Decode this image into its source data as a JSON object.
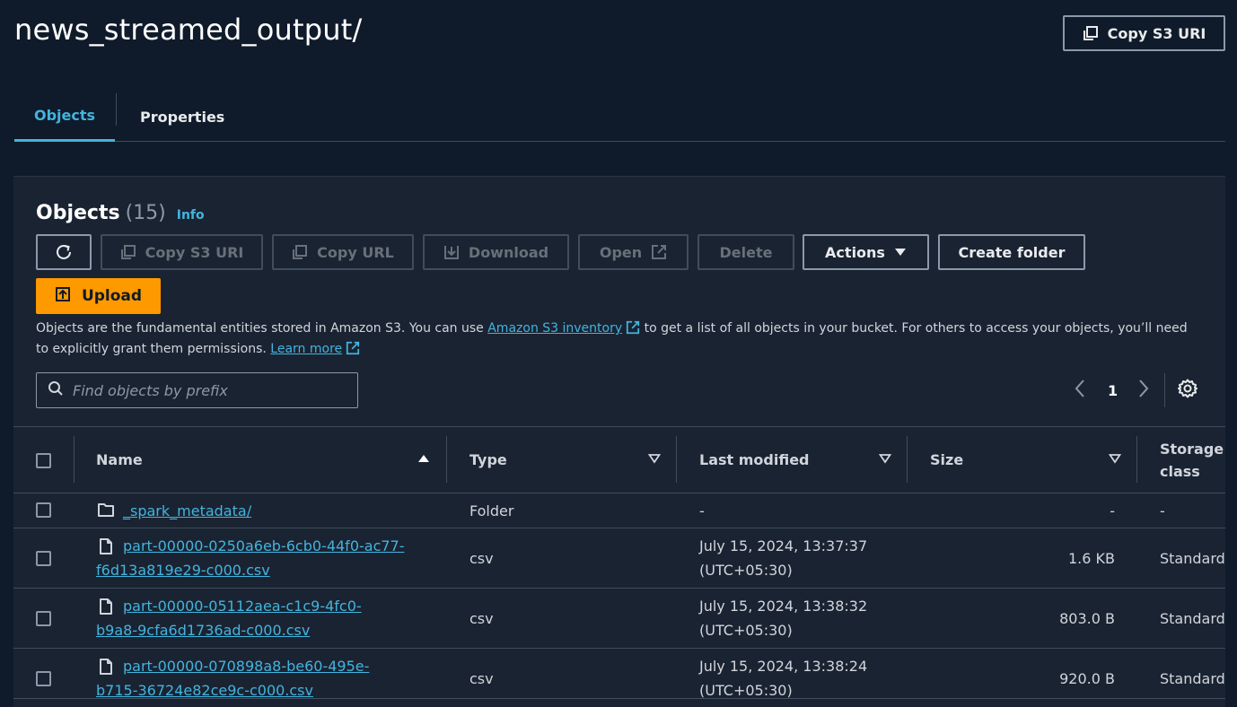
{
  "header": {
    "title": "news_streamed_output/",
    "copy_s3_uri_label": "Copy S3 URI"
  },
  "tabs": [
    {
      "label": "Objects",
      "active": true
    },
    {
      "label": "Properties",
      "active": false
    }
  ],
  "objects_panel": {
    "title": "Objects",
    "count": "(15)",
    "info_label": "Info",
    "toolbar": {
      "copy_s3_uri": "Copy S3 URI",
      "copy_url": "Copy URL",
      "download": "Download",
      "open": "Open",
      "delete": "Delete",
      "actions": "Actions",
      "create_folder": "Create folder",
      "upload": "Upload"
    },
    "description": {
      "part1": "Objects are the fundamental entities stored in Amazon S3. You can use ",
      "inventory_link": "Amazon S3 inventory",
      "part2": " to get a list of all objects in your bucket. For others to access your objects, you’ll need to explicitly grant them permissions. ",
      "learn_more_link": "Learn more"
    },
    "search": {
      "placeholder": "Find objects by prefix",
      "value": ""
    },
    "pagination": {
      "current_page": "1"
    }
  },
  "table": {
    "columns": [
      "Name",
      "Type",
      "Last modified",
      "Size",
      "Storage class"
    ],
    "rows": [
      {
        "name_line1": "_spark_metadata/",
        "name_line2": "",
        "type": "Folder",
        "modified_line1": "-",
        "modified_line2": "",
        "size": "-",
        "storage": "-",
        "kind": "folder"
      },
      {
        "name_line1": "part-00000-0250a6eb-6cb0-44f0-ac77-",
        "name_line2": "f6d13a819e29-c000.csv",
        "type": "csv",
        "modified_line1": "July 15, 2024, 13:37:37",
        "modified_line2": "(UTC+05:30)",
        "size": "1.6 KB",
        "storage": "Standard",
        "kind": "file"
      },
      {
        "name_line1": "part-00000-05112aea-c1c9-4fc0-",
        "name_line2": "b9a8-9cfa6d1736ad-c000.csv",
        "type": "csv",
        "modified_line1": "July 15, 2024, 13:38:32",
        "modified_line2": "(UTC+05:30)",
        "size": "803.0 B",
        "storage": "Standard",
        "kind": "file"
      },
      {
        "name_line1": "part-00000-070898a8-be60-495e-",
        "name_line2": "b715-36724e82ce9c-c000.csv",
        "type": "csv",
        "modified_line1": "July 15, 2024, 13:38:24",
        "modified_line2": "(UTC+05:30)",
        "size": "920.0 B",
        "storage": "Standard",
        "kind": "file"
      }
    ]
  },
  "colors": {
    "background": "#0f1b2a",
    "panel": "#1a2332",
    "accent_link": "#42b4dd",
    "upload_orange": "#ff9900"
  }
}
